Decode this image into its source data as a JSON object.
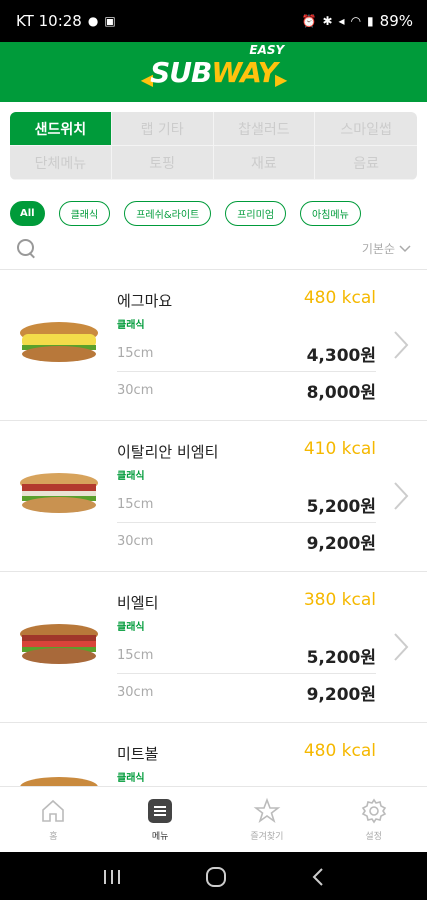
{
  "status": {
    "carrier_time": "KT 10:28",
    "battery": "89%"
  },
  "header": {
    "logo_sub": "SUB",
    "logo_way": "WAY",
    "logo_easy": "EASY"
  },
  "tabs": [
    {
      "label": "샌드위치",
      "active": true
    },
    {
      "label": "랩 기타",
      "active": false
    },
    {
      "label": "찹샐러드",
      "active": false
    },
    {
      "label": "스마일썹",
      "active": false
    },
    {
      "label": "단체메뉴",
      "active": false
    },
    {
      "label": "토핑",
      "active": false
    },
    {
      "label": "재료",
      "active": false
    },
    {
      "label": "음료",
      "active": false
    }
  ],
  "chips": [
    {
      "label": "All",
      "active": true
    },
    {
      "label": "클래식",
      "active": false
    },
    {
      "label": "프레쉬&라이트",
      "active": false
    },
    {
      "label": "프리미엄",
      "active": false
    },
    {
      "label": "아침메뉴",
      "active": false
    }
  ],
  "sort_label": "기본순",
  "items": [
    {
      "name": "에그마요",
      "category": "클래식",
      "kcal": "480 kcal",
      "size1": "15cm",
      "price1": "4,300원",
      "size2": "30cm",
      "price2": "8,000원",
      "filling": "egg"
    },
    {
      "name": "이탈리안 비엠티",
      "category": "클래식",
      "kcal": "410 kcal",
      "size1": "15cm",
      "price1": "5,200원",
      "size2": "30cm",
      "price2": "9,200원",
      "filling": "ham"
    },
    {
      "name": "비엘티",
      "category": "클래식",
      "kcal": "380 kcal",
      "size1": "15cm",
      "price1": "5,200원",
      "size2": "30cm",
      "price2": "9,200원",
      "filling": "bacon"
    },
    {
      "name": "미트볼",
      "category": "클래식",
      "kcal": "480 kcal",
      "size1": "",
      "price1": "",
      "size2": "",
      "price2": "",
      "filling": "meatball"
    }
  ],
  "bottom_nav": [
    {
      "label": "홈",
      "icon": "home-icon",
      "active": false
    },
    {
      "label": "메뉴",
      "icon": "menu-icon",
      "active": true
    },
    {
      "label": "즐겨찾기",
      "icon": "star-icon",
      "active": false
    },
    {
      "label": "설정",
      "icon": "gear-icon",
      "active": false
    }
  ],
  "colors": {
    "brand_green": "#009b3a",
    "brand_yellow": "#ffc20e",
    "kcal": "#f5b800"
  }
}
